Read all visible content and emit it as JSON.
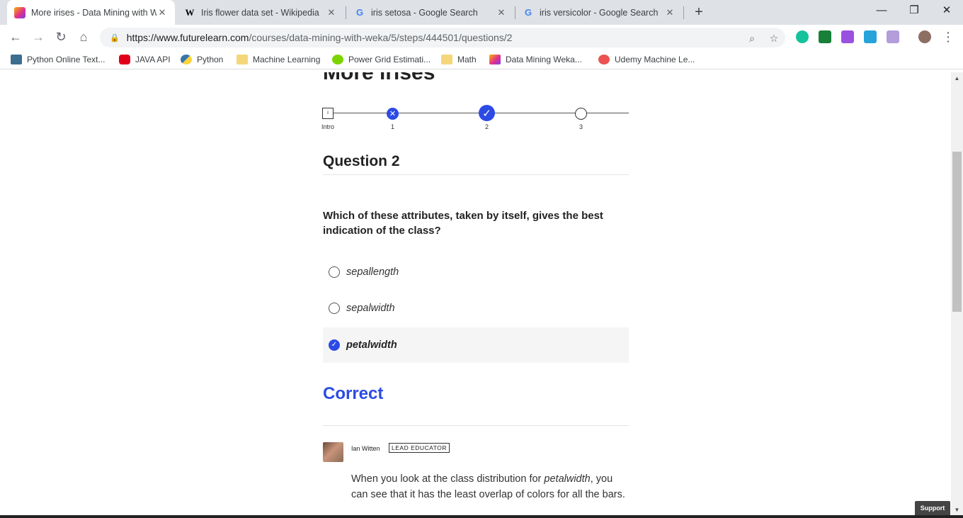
{
  "browser": {
    "tabs": [
      {
        "title": "More irises - Data Mining with W",
        "favicon": "futurelearn-icon",
        "active": true
      },
      {
        "title": "Iris flower data set - Wikipedia",
        "favicon": "wikipedia-icon",
        "favicon_glyph": "W",
        "active": false
      },
      {
        "title": "iris setosa - Google Search",
        "favicon": "google-icon",
        "favicon_glyph": "G",
        "active": false
      },
      {
        "title": "iris versicolor - Google Search",
        "favicon": "google-icon",
        "favicon_glyph": "G",
        "active": false
      }
    ],
    "tab_close_glyph": "✕",
    "new_tab_glyph": "+",
    "window": {
      "minimize": "—",
      "restore": "❐",
      "close": "✕"
    },
    "nav": {
      "back": "←",
      "forward": "→",
      "reload": "↻",
      "home": "⌂"
    },
    "address": {
      "host": "https://www.futurelearn.com",
      "path": "/courses/data-mining-with-weka/5/steps/444501/questions/2"
    },
    "omnibox_icons": {
      "zoom": "⌕",
      "star": "☆"
    },
    "menu_glyph": "⋮",
    "extensions": [
      {
        "name": "grammarly-icon",
        "color": "#15c39a"
      },
      {
        "name": "cast-icon",
        "color": "#188038"
      },
      {
        "name": "extension-puzzle-icon",
        "color": "#9b51e0"
      },
      {
        "name": "extension-cloud-icon",
        "color": "#26a3d9"
      },
      {
        "name": "extension-purple-icon",
        "color": "#b39ddb"
      },
      {
        "name": "profile-avatar-icon",
        "color": "#8d6e63"
      }
    ],
    "bookmarks": [
      {
        "label": "Python Online Text...",
        "icon": "python-text-icon",
        "color": "#3c6e8f"
      },
      {
        "label": "JAVA API",
        "icon": "oracle-icon",
        "color": "#e0001a"
      },
      {
        "label": "Python",
        "icon": "python-icon",
        "color": "#3776ab"
      },
      {
        "label": "Machine Learning",
        "icon": "folder-icon",
        "color": "#f4d77a"
      },
      {
        "label": "Power Grid Estimati...",
        "icon": "smiley-icon",
        "color": "#7bd400"
      },
      {
        "label": "Math",
        "icon": "folder-icon",
        "color": "#f4d77a"
      },
      {
        "label": "Data Mining Weka...",
        "icon": "futurelearn-icon",
        "color": "#e2308a"
      },
      {
        "label": "Udemy Machine Le...",
        "icon": "udemy-icon",
        "color": "#ec5252"
      }
    ]
  },
  "page": {
    "title": "More irises",
    "progress": {
      "steps": [
        {
          "label": "Intro",
          "state": "intro",
          "glyph": "i"
        },
        {
          "label": "1",
          "state": "incorrect",
          "glyph": "✕"
        },
        {
          "label": "2",
          "state": "correct",
          "glyph": "✓"
        },
        {
          "label": "3",
          "state": "pending",
          "glyph": ""
        }
      ]
    },
    "question": {
      "heading": "Question 2",
      "text": "Which of these attributes, taken by itself, gives the best indication of the class?",
      "options": [
        {
          "label": "sepallength",
          "selected": false
        },
        {
          "label": "sepalwidth",
          "selected": false
        },
        {
          "label": "petalwidth",
          "selected": true
        }
      ],
      "check_glyph": "✓"
    },
    "result": "Correct",
    "feedback": {
      "author": "Ian Witten",
      "badge": "LEAD EDUCATOR",
      "text_before": "When you look at the class distribution for ",
      "text_emphasis": "petalwidth",
      "text_after": ", you can see that it has the least overlap of colors for all the bars."
    },
    "support_label": "Support",
    "accent_color": "#2c4be5"
  }
}
